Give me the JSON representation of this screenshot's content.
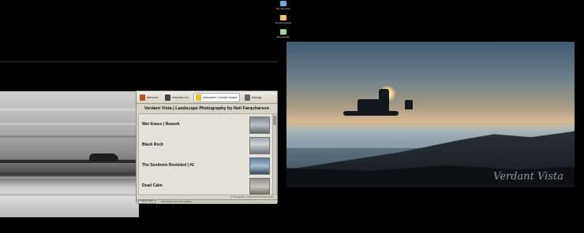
{
  "desktop": {
    "icons": [
      {
        "label": "My Computer",
        "icon": "computer-icon",
        "color": "#7aa6d8"
      },
      {
        "label": "My Documents",
        "icon": "folder-icon",
        "color": "#e6c65a"
      },
      {
        "label": "Recycle Bin",
        "icon": "recycle-bin-icon",
        "color": "#9fd4a0"
      }
    ]
  },
  "app": {
    "tabs": [
      {
        "label": "Welcome",
        "icon": "home-icon"
      },
      {
        "label": "Channels List",
        "icon": "list-icon"
      },
      {
        "label": "Subscribed Channel Images",
        "icon": "star-icon"
      },
      {
        "label": "Settings",
        "icon": "gear-icon"
      }
    ],
    "title": "Verdant Vista | Landscape Photography by Neil Farquharson",
    "entries": [
      {
        "title": "Wet Knees | Rework"
      },
      {
        "title": "Black Rock"
      },
      {
        "title": "The Sentinels Revisited | #2"
      },
      {
        "title": "Dead Calm"
      }
    ],
    "credit": "VV Photography © 2010-2013 Neil Farquharson",
    "status": {
      "button": "Change Mode",
      "text": "Next Change: 2hr 12min 03/08/13"
    }
  },
  "right_photo": {
    "watermark": "Verdant Vista"
  },
  "colors": {
    "app_bg": "#d8d4c8",
    "desktop_bg": "#000000"
  }
}
